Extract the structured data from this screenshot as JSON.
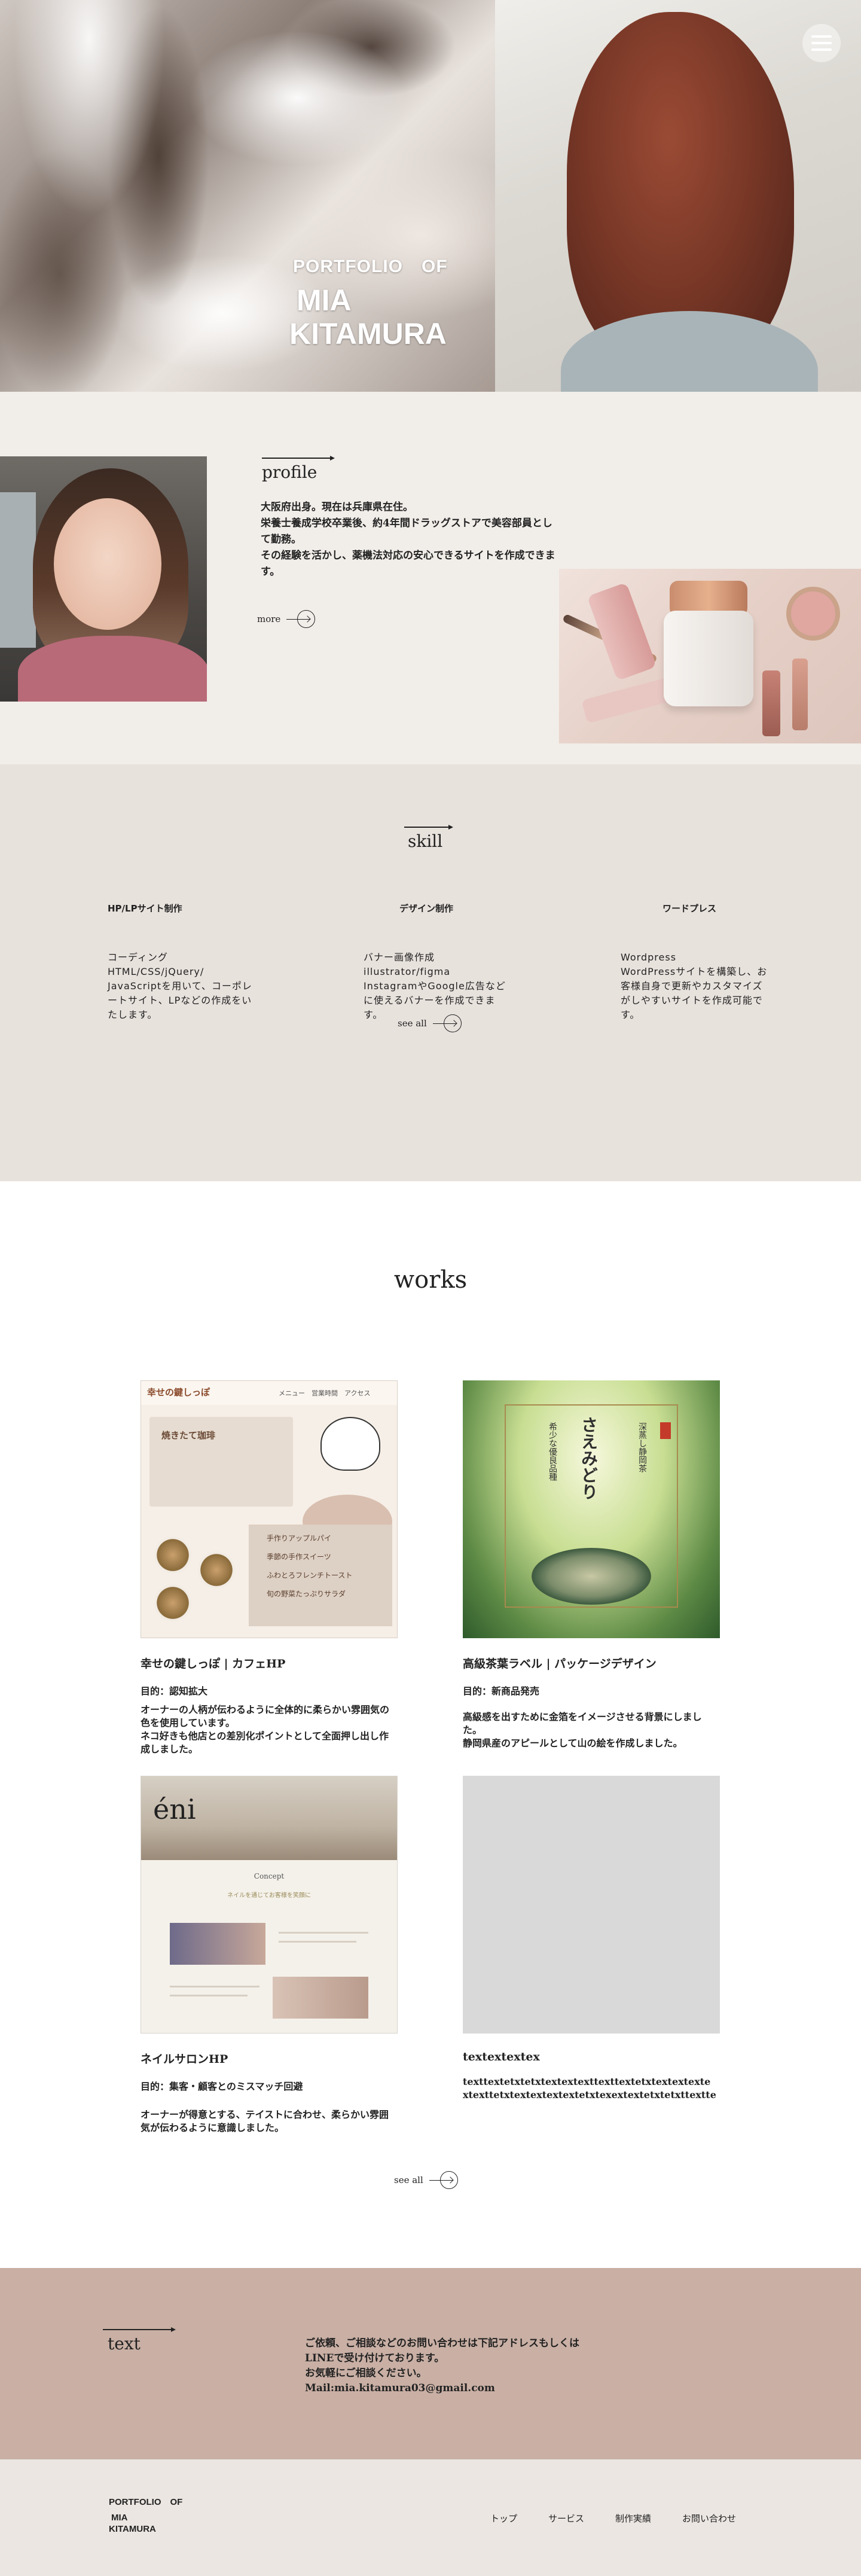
{
  "hero": {
    "title_line1": "PORTFOLIO　OF",
    "title_line2": "MIA",
    "title_line3": "KITAMURA"
  },
  "profile": {
    "heading": "profile",
    "text": "大阪府出身。現在は兵庫県在住。\n栄養士養成学校卒業後、約4年間ドラッグストアで美容部員として勤務。\nその経験を活かし、薬機法対応の安心できるサイトを作成できます。",
    "more_label": "more"
  },
  "skill": {
    "heading": "skill",
    "items": [
      {
        "title": "HP/LPサイト制作",
        "desc": "コーディング\nHTML/CSS/jQuery/\nJavaScriptを用いて、コーポレートサイト、LPなどの作成をいたします。"
      },
      {
        "title": "デザイン制作",
        "desc": "バナー画像作成\nillustrator/figma\nInstagramやGoogle広告などに使えるバナーを作成できます。"
      },
      {
        "title": "ワードプレス",
        "desc": "Wordpress\nWordPressサイトを構築し、お客様自身で更新やカスタマイズがしやすいサイトを作成可能です。"
      }
    ],
    "see_all_label": "see all"
  },
  "works": {
    "heading": "works",
    "items": [
      {
        "title": "幸せの鍵しっぽ | カフェHP",
        "purpose": "目的：認知拡大",
        "desc": "オーナーの人柄が伝わるように全体的に柔らかい雰囲気の色を使用しています。\nネコ好きも他店との差別化ポイントとして全面押し出し作成しました。",
        "thumb": {
          "logo": "幸せの鍵しっぽ",
          "nav": "メニュー　営業時間　アクセス",
          "box_title": "焼きたて珈琲",
          "menu": [
            "手作りアップルパイ",
            "季節の手作スイーツ",
            "ふわとろフレンチトースト",
            "旬の野菜たっぷりサラダ"
          ]
        }
      },
      {
        "title": "高級茶葉ラベル | パッケージデザイン",
        "purpose": "目的：新商品発売",
        "desc": "高級感を出すために金箔をイメージさせる背景にしました。\n静岡県産のアピールとして山の絵を作成しました。",
        "thumb": {
          "name": "さえみどり",
          "left_text": "希少な優良品種",
          "right_text": "深蒸し静岡茶",
          "badge": "静岡県産"
        }
      },
      {
        "title": "ネイルサロンHP",
        "purpose": "目的：集客・顧客とのミスマッチ回避",
        "desc": "オーナーが得意とする、テイストに合わせ、柔らかい雰囲気が伝わるように意識しました。",
        "thumb": {
          "brand": "éni",
          "concept": "Concept",
          "sub": "ネイルを通じてお客様を笑顔に"
        }
      },
      {
        "title": "textextextex",
        "purpose": "",
        "desc": "texttextetxtetxtextextexttexttextetxtextextexte\nxtexttetxtextextextextetxtexextextetxtetxttextte",
        "thumb": {}
      }
    ],
    "see_all_label": "see all"
  },
  "contact": {
    "heading": "text",
    "text": "ご依頼、ご相談などのお問い合わせは下記アドレスもしくは\nLINEで受け付けております。\nお気軽にご相談ください。\nMail:mia.kitamura03@gmail.com"
  },
  "footer": {
    "logo_line1": "PORTFOLIO　OF",
    "logo_line2": "MIA",
    "logo_line3": "KITAMURA",
    "nav": [
      "トップ",
      "サービス",
      "制作実績",
      "お問い合わせ"
    ]
  },
  "icons": {
    "menu": "hamburger-icon",
    "arrow": "arrow-circle-icon"
  }
}
